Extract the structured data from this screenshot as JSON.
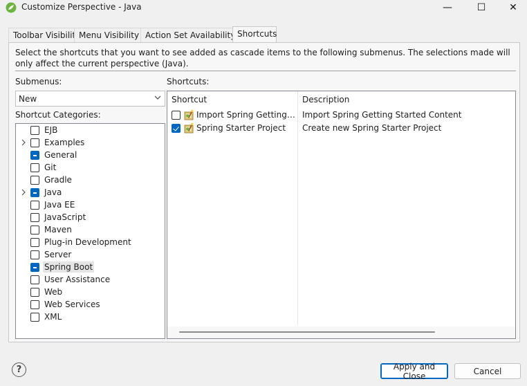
{
  "window": {
    "title": "Customize Perspective - Java",
    "minimize_glyph": "—",
    "maximize_glyph": "☐",
    "close_glyph": "✕"
  },
  "tabs": [
    {
      "label": "Toolbar Visibility",
      "active": false
    },
    {
      "label": "Menu Visibility",
      "active": false
    },
    {
      "label": "Action Set Availability",
      "active": false
    },
    {
      "label": "Shortcuts",
      "active": true
    }
  ],
  "description": "Select the shortcuts that you want to see added as cascade items to the following submenus. The selections made will only affect the current perspective (Java).",
  "submenus": {
    "label": "Submenus:",
    "selected": "New"
  },
  "categories": {
    "label": "Shortcut Categories:",
    "items": [
      {
        "label": "EJB",
        "state": "unchecked",
        "expandable": false,
        "selected": false
      },
      {
        "label": "Examples",
        "state": "unchecked",
        "expandable": true,
        "selected": false
      },
      {
        "label": "General",
        "state": "partial",
        "expandable": false,
        "selected": false
      },
      {
        "label": "Git",
        "state": "unchecked",
        "expandable": false,
        "selected": false
      },
      {
        "label": "Gradle",
        "state": "unchecked",
        "expandable": false,
        "selected": false
      },
      {
        "label": "Java",
        "state": "partial",
        "expandable": true,
        "selected": false
      },
      {
        "label": "Java EE",
        "state": "unchecked",
        "expandable": false,
        "selected": false
      },
      {
        "label": "JavaScript",
        "state": "unchecked",
        "expandable": false,
        "selected": false
      },
      {
        "label": "Maven",
        "state": "unchecked",
        "expandable": false,
        "selected": false
      },
      {
        "label": "Plug-in Development",
        "state": "unchecked",
        "expandable": false,
        "selected": false
      },
      {
        "label": "Server",
        "state": "unchecked",
        "expandable": false,
        "selected": false
      },
      {
        "label": "Spring Boot",
        "state": "partial",
        "expandable": false,
        "selected": true
      },
      {
        "label": "User Assistance",
        "state": "unchecked",
        "expandable": false,
        "selected": false
      },
      {
        "label": "Web",
        "state": "unchecked",
        "expandable": false,
        "selected": false
      },
      {
        "label": "Web Services",
        "state": "unchecked",
        "expandable": false,
        "selected": false
      },
      {
        "label": "XML",
        "state": "unchecked",
        "expandable": false,
        "selected": false
      }
    ]
  },
  "shortcuts": {
    "label": "Shortcuts:",
    "columns": [
      "Shortcut",
      "Description"
    ],
    "rows": [
      {
        "name": "Import Spring Getting St...",
        "description": "Import Spring Getting Started Content",
        "checked": false,
        "icon": "spring-wizard-icon"
      },
      {
        "name": "Spring Starter Project",
        "description": "Create new Spring Starter Project",
        "checked": true,
        "icon": "spring-wizard-icon"
      }
    ]
  },
  "footer": {
    "help_glyph": "?",
    "apply_label": "Apply and Close",
    "cancel_label": "Cancel"
  },
  "colors": {
    "accent": "#0067c0",
    "spring_green": "#6db33f"
  }
}
